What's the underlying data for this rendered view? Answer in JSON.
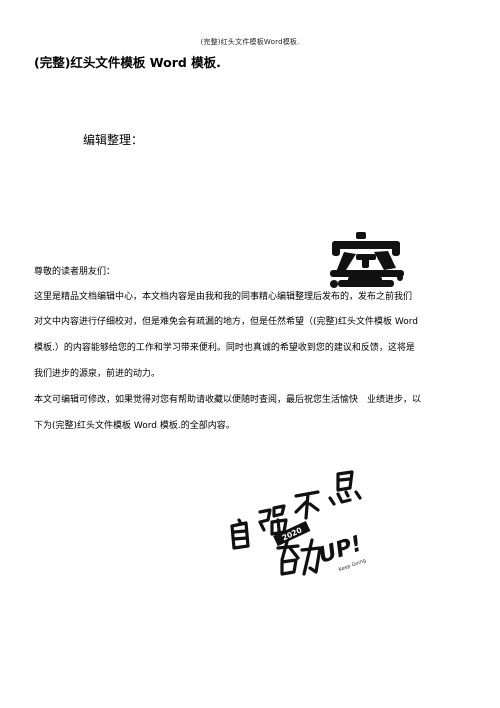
{
  "header": {
    "running_title": "(完整)红头文件模板Word模板."
  },
  "document": {
    "title": "(完整)红头文件模板 Word 模板.",
    "editor_label": "编辑整理：",
    "greeting": "尊敬的读者朋友们：",
    "paragraph1_lines": [
      "这里是精品文档编辑中心，本文档内容是由我和我的同事精心编辑整理后发布的，发布之前我们",
      "对文中内容进行仔细校对，但是难免会有疏漏的地方，但是任然希望（(完整)红头文件模板 Word",
      "模板.）的内容能够给您的工作和学习带来便利。同时也真诚的希望收到您的建议和反馈，这将是",
      "我们进步的源泉，前进的动力。"
    ],
    "paragraph2_lines": [
      "本文可编辑可修改，如果觉得对您有帮助请收藏以便随时查阅，最后祝您生活愉快　业绩进步，以",
      "下为(完整)红头文件模板 Word 模板.的全部内容。"
    ]
  },
  "graphics": {
    "stamp_icon": "calligraphy-stamp-icon",
    "motto_icon": "handwritten-motto-graphic",
    "motto_text": "自强不息 奋力UP! 2020 Keep Going"
  }
}
